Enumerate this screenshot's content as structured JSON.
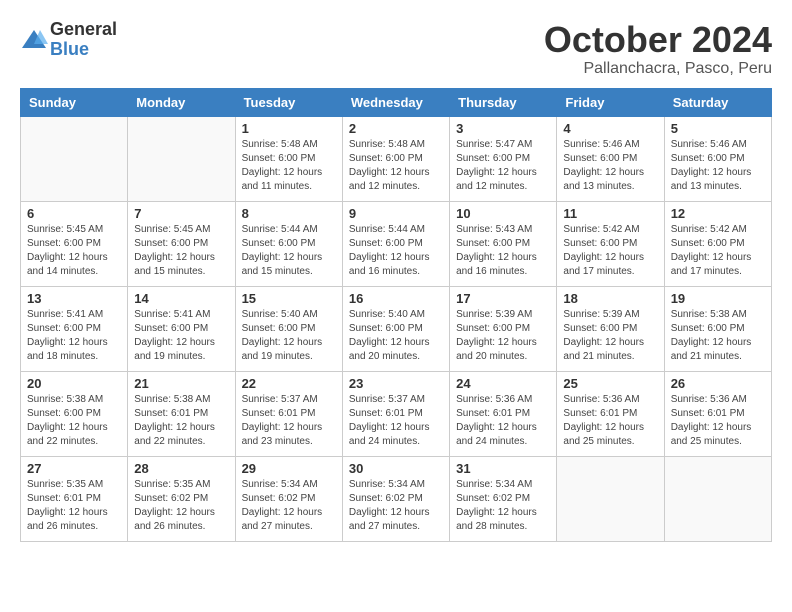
{
  "header": {
    "logo": {
      "general": "General",
      "blue": "Blue"
    },
    "title": "October 2024",
    "subtitle": "Pallanchacra, Pasco, Peru"
  },
  "calendar": {
    "days_of_week": [
      "Sunday",
      "Monday",
      "Tuesday",
      "Wednesday",
      "Thursday",
      "Friday",
      "Saturday"
    ],
    "weeks": [
      [
        {
          "day": "",
          "info": ""
        },
        {
          "day": "",
          "info": ""
        },
        {
          "day": "1",
          "info": "Sunrise: 5:48 AM\nSunset: 6:00 PM\nDaylight: 12 hours and 11 minutes."
        },
        {
          "day": "2",
          "info": "Sunrise: 5:48 AM\nSunset: 6:00 PM\nDaylight: 12 hours and 12 minutes."
        },
        {
          "day": "3",
          "info": "Sunrise: 5:47 AM\nSunset: 6:00 PM\nDaylight: 12 hours and 12 minutes."
        },
        {
          "day": "4",
          "info": "Sunrise: 5:46 AM\nSunset: 6:00 PM\nDaylight: 12 hours and 13 minutes."
        },
        {
          "day": "5",
          "info": "Sunrise: 5:46 AM\nSunset: 6:00 PM\nDaylight: 12 hours and 13 minutes."
        }
      ],
      [
        {
          "day": "6",
          "info": "Sunrise: 5:45 AM\nSunset: 6:00 PM\nDaylight: 12 hours and 14 minutes."
        },
        {
          "day": "7",
          "info": "Sunrise: 5:45 AM\nSunset: 6:00 PM\nDaylight: 12 hours and 15 minutes."
        },
        {
          "day": "8",
          "info": "Sunrise: 5:44 AM\nSunset: 6:00 PM\nDaylight: 12 hours and 15 minutes."
        },
        {
          "day": "9",
          "info": "Sunrise: 5:44 AM\nSunset: 6:00 PM\nDaylight: 12 hours and 16 minutes."
        },
        {
          "day": "10",
          "info": "Sunrise: 5:43 AM\nSunset: 6:00 PM\nDaylight: 12 hours and 16 minutes."
        },
        {
          "day": "11",
          "info": "Sunrise: 5:42 AM\nSunset: 6:00 PM\nDaylight: 12 hours and 17 minutes."
        },
        {
          "day": "12",
          "info": "Sunrise: 5:42 AM\nSunset: 6:00 PM\nDaylight: 12 hours and 17 minutes."
        }
      ],
      [
        {
          "day": "13",
          "info": "Sunrise: 5:41 AM\nSunset: 6:00 PM\nDaylight: 12 hours and 18 minutes."
        },
        {
          "day": "14",
          "info": "Sunrise: 5:41 AM\nSunset: 6:00 PM\nDaylight: 12 hours and 19 minutes."
        },
        {
          "day": "15",
          "info": "Sunrise: 5:40 AM\nSunset: 6:00 PM\nDaylight: 12 hours and 19 minutes."
        },
        {
          "day": "16",
          "info": "Sunrise: 5:40 AM\nSunset: 6:00 PM\nDaylight: 12 hours and 20 minutes."
        },
        {
          "day": "17",
          "info": "Sunrise: 5:39 AM\nSunset: 6:00 PM\nDaylight: 12 hours and 20 minutes."
        },
        {
          "day": "18",
          "info": "Sunrise: 5:39 AM\nSunset: 6:00 PM\nDaylight: 12 hours and 21 minutes."
        },
        {
          "day": "19",
          "info": "Sunrise: 5:38 AM\nSunset: 6:00 PM\nDaylight: 12 hours and 21 minutes."
        }
      ],
      [
        {
          "day": "20",
          "info": "Sunrise: 5:38 AM\nSunset: 6:00 PM\nDaylight: 12 hours and 22 minutes."
        },
        {
          "day": "21",
          "info": "Sunrise: 5:38 AM\nSunset: 6:01 PM\nDaylight: 12 hours and 22 minutes."
        },
        {
          "day": "22",
          "info": "Sunrise: 5:37 AM\nSunset: 6:01 PM\nDaylight: 12 hours and 23 minutes."
        },
        {
          "day": "23",
          "info": "Sunrise: 5:37 AM\nSunset: 6:01 PM\nDaylight: 12 hours and 24 minutes."
        },
        {
          "day": "24",
          "info": "Sunrise: 5:36 AM\nSunset: 6:01 PM\nDaylight: 12 hours and 24 minutes."
        },
        {
          "day": "25",
          "info": "Sunrise: 5:36 AM\nSunset: 6:01 PM\nDaylight: 12 hours and 25 minutes."
        },
        {
          "day": "26",
          "info": "Sunrise: 5:36 AM\nSunset: 6:01 PM\nDaylight: 12 hours and 25 minutes."
        }
      ],
      [
        {
          "day": "27",
          "info": "Sunrise: 5:35 AM\nSunset: 6:01 PM\nDaylight: 12 hours and 26 minutes."
        },
        {
          "day": "28",
          "info": "Sunrise: 5:35 AM\nSunset: 6:02 PM\nDaylight: 12 hours and 26 minutes."
        },
        {
          "day": "29",
          "info": "Sunrise: 5:34 AM\nSunset: 6:02 PM\nDaylight: 12 hours and 27 minutes."
        },
        {
          "day": "30",
          "info": "Sunrise: 5:34 AM\nSunset: 6:02 PM\nDaylight: 12 hours and 27 minutes."
        },
        {
          "day": "31",
          "info": "Sunrise: 5:34 AM\nSunset: 6:02 PM\nDaylight: 12 hours and 28 minutes."
        },
        {
          "day": "",
          "info": ""
        },
        {
          "day": "",
          "info": ""
        }
      ]
    ]
  }
}
